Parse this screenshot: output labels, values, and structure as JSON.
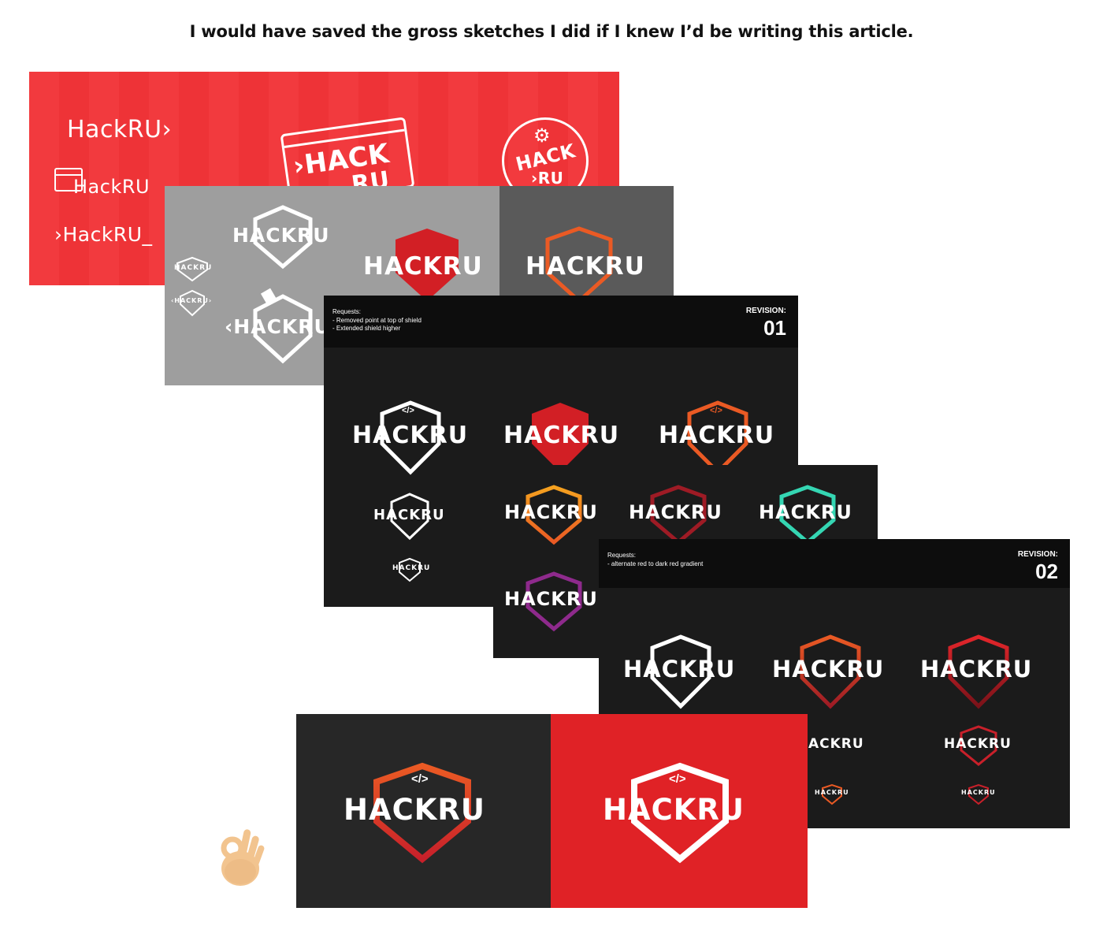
{
  "caption": "I would have saved the gross sketches I did if I knew I’d be writing this article.",
  "logo_text": "HACKRU",
  "code_glyph": "</>",
  "sketches": {
    "wordmark_1": "HackRU›",
    "wordmark_2": "HackRU",
    "wordmark_3": "›HackRU_",
    "stacked_1": "›HACK",
    "stacked_2": "RU",
    "badge_1": "HACK",
    "badge_2": "›RU_"
  },
  "gray_panel": {
    "small_1": "HACKRU",
    "small_2": "‹HACKRU›",
    "large_1": "HACKRU",
    "large_2": "‹HACKRU"
  },
  "revision_01": {
    "requests_title": "Requests:",
    "requests": [
      "- Removed point at top of shield",
      "- Extended shield higher"
    ],
    "label": "REVISION:",
    "number": "01"
  },
  "revision_02": {
    "requests_title": "Requests:",
    "requests": [
      "- alternate red to dark red gradient"
    ],
    "label": "REVISION:",
    "number": "02",
    "partial_text": "ACKRU"
  },
  "colors": {
    "white": "#ffffff",
    "red": "#e3262b",
    "orange": "#ea5a24",
    "yellow": "#f5a21f",
    "dark_red": "#9e1b25",
    "teal": "#35d6b3",
    "purple": "#8e2a8c"
  }
}
